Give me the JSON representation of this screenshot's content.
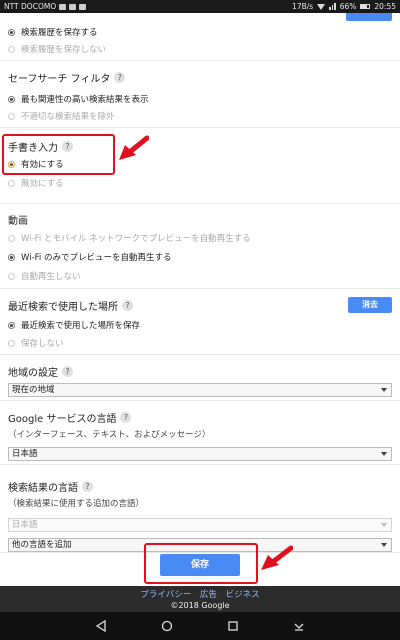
{
  "status_bar": {
    "carrier": "NTT DOCOMO",
    "data_speed": "17B/s",
    "battery": "66%",
    "time": "20:55"
  },
  "history": {
    "options": [
      {
        "label": "検索履歴を保存する",
        "selected": true,
        "disabled": false
      },
      {
        "label": "検索履歴を保存しない",
        "selected": false,
        "disabled": true
      }
    ]
  },
  "safesearch": {
    "title": "セーフサーチ フィルタ",
    "help": "?",
    "options": [
      {
        "label": "最も関連性の高い検索結果を表示",
        "selected": true,
        "disabled": false
      },
      {
        "label": "不適切な検索結果を除外",
        "selected": false,
        "disabled": true
      }
    ]
  },
  "handwriting": {
    "title": "手書き入力",
    "help": "?",
    "options": [
      {
        "label": "有効にする",
        "selected": true,
        "disabled": false
      },
      {
        "label": "無効にする",
        "selected": false,
        "disabled": true
      }
    ]
  },
  "video": {
    "title": "動画",
    "options": [
      {
        "label": "Wi-Fi とモバイル ネットワークでプレビューを自動再生する",
        "selected": false,
        "disabled": true
      },
      {
        "label": "Wi-Fi のみでプレビューを自動再生する",
        "selected": true,
        "disabled": false
      },
      {
        "label": "自動再生しない",
        "selected": false,
        "disabled": true
      }
    ]
  },
  "recent_places": {
    "title": "最近検索で使用した場所",
    "help": "?",
    "clear_label": "消去",
    "options": [
      {
        "label": "最近検索で使用した場所を保存",
        "selected": true,
        "disabled": false
      },
      {
        "label": "保存しない",
        "selected": false,
        "disabled": true
      }
    ]
  },
  "region": {
    "title": "地域の設定",
    "help": "?",
    "selected": "現在の地域"
  },
  "service_language": {
    "title": "Google サービスの言語",
    "help": "?",
    "subtitle": "（インターフェース、テキスト、およびメッセージ）",
    "selected": "日本語"
  },
  "results_language": {
    "title": "検索結果の言語",
    "help": "?",
    "subtitle": "（検索結果に使用する追加の言語）",
    "selected_disabled": "日本語",
    "add_language": "他の言語を追加"
  },
  "save_label": "保存",
  "footer": {
    "links": [
      "プライバシー",
      "広告",
      "ビジネス"
    ],
    "copyright": "©2018 Google"
  },
  "colors": {
    "accent_blue": "#4a8af4",
    "highlight_red": "#e0101e"
  }
}
